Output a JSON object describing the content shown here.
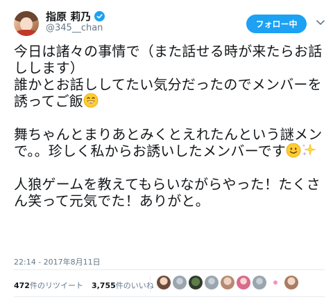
{
  "header": {
    "display_name": "指原 莉乃",
    "handle": "@345__chan",
    "follow_label": "フォロー中",
    "accent_color": "#1da1f2"
  },
  "tweet": {
    "paragraphs": [
      "今日は諸々の事情で（また話せる時が来たらお話しします）",
      "誰かとお話ししてたい気分だったのでメンバーを誘ってご飯",
      "舞ちゃんとまりあとみくとえれたんという謎メンで。。珍しく私からお誘いしたメンバーです",
      "人狼ゲームを教えてもらいながらやった！たくさん笑って元気でた！ありがと。"
    ],
    "timestamp": "22:14 - 2017年8月11日"
  },
  "stats": {
    "retweets_count": "472",
    "retweets_label": "件のリツイート",
    "likes_count": "3,755",
    "likes_label": "件のいいね"
  },
  "likers": [
    {
      "icon": "avatar-1"
    },
    {
      "icon": "avatar-2"
    },
    {
      "icon": "avatar-3"
    },
    {
      "icon": "avatar-4"
    },
    {
      "icon": "avatar-5"
    },
    {
      "icon": "avatar-6"
    },
    {
      "icon": "avatar-7"
    },
    {
      "icon": "avatar-8"
    },
    {
      "icon": "avatar-9"
    }
  ]
}
